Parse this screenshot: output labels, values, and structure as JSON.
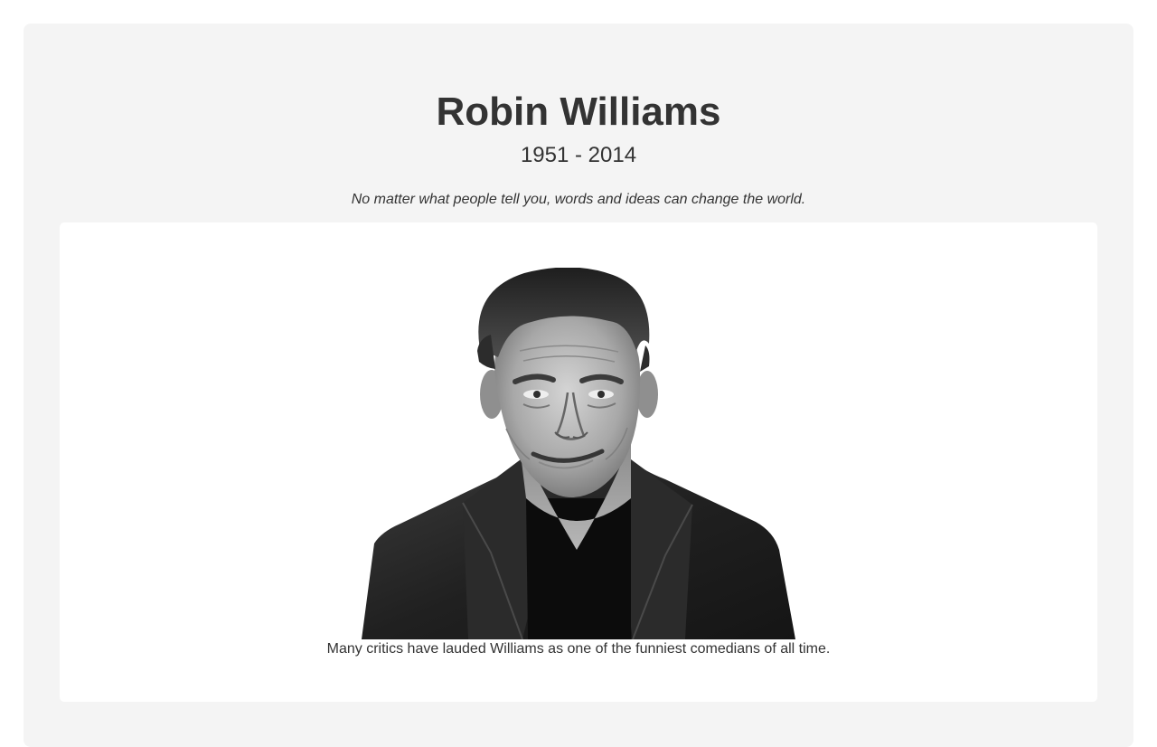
{
  "page": {
    "title": "Robin Williams",
    "lifespan": "1951 - 2014",
    "quote": "No matter what people tell you, words and ideas can change the world."
  },
  "card": {
    "image": {
      "icon": "portrait-photo-black-and-white"
    },
    "caption": "Many critics have lauded Williams as one of the funniest comedians of all time."
  },
  "colors": {
    "page_background": "#ffffff",
    "container_background": "#f4f4f4",
    "card_background": "#ffffff",
    "text": "#333333"
  }
}
